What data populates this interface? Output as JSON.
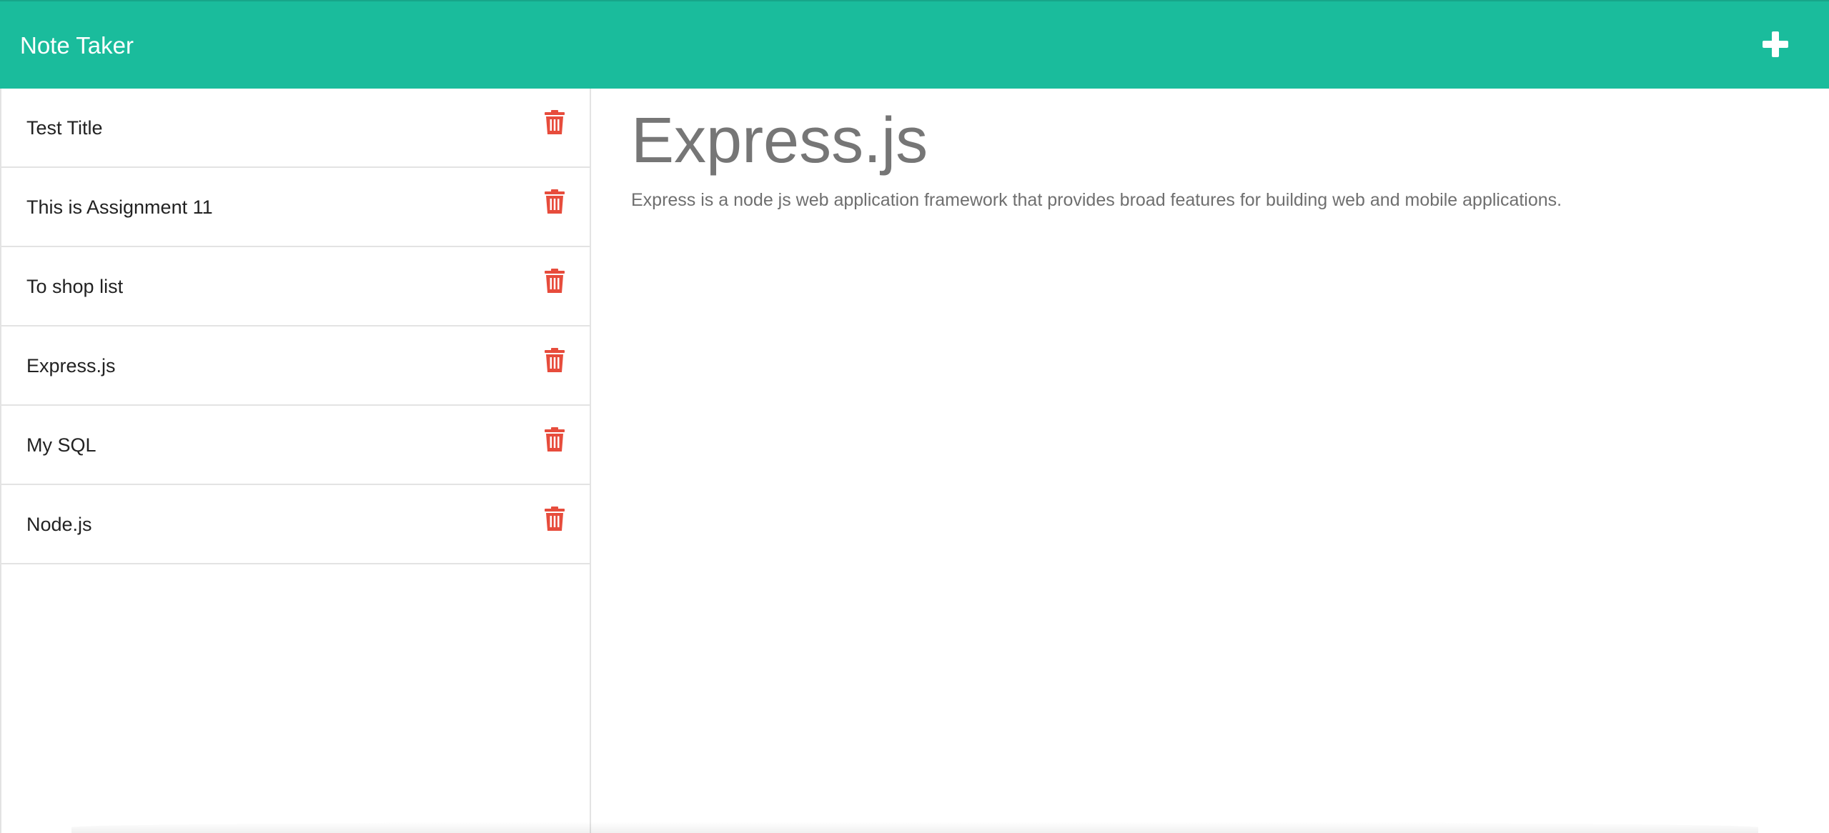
{
  "navbar": {
    "brand": "Note Taker",
    "new_note_icon": "plus-icon"
  },
  "sidebar": {
    "delete_icon": "trash-icon",
    "delete_icon_color": "#e74c3c",
    "items": [
      {
        "label": "Test Title"
      },
      {
        "label": "This is Assignment 11"
      },
      {
        "label": "To shop list"
      },
      {
        "label": "Express.js"
      },
      {
        "label": "My SQL"
      },
      {
        "label": "Node.js"
      }
    ]
  },
  "main": {
    "title": "Express.js",
    "text": "Express is a node js web application framework that provides broad features for building web and mobile applications."
  },
  "colors": {
    "navbar": "#1abc9c",
    "title_text": "#767676"
  }
}
